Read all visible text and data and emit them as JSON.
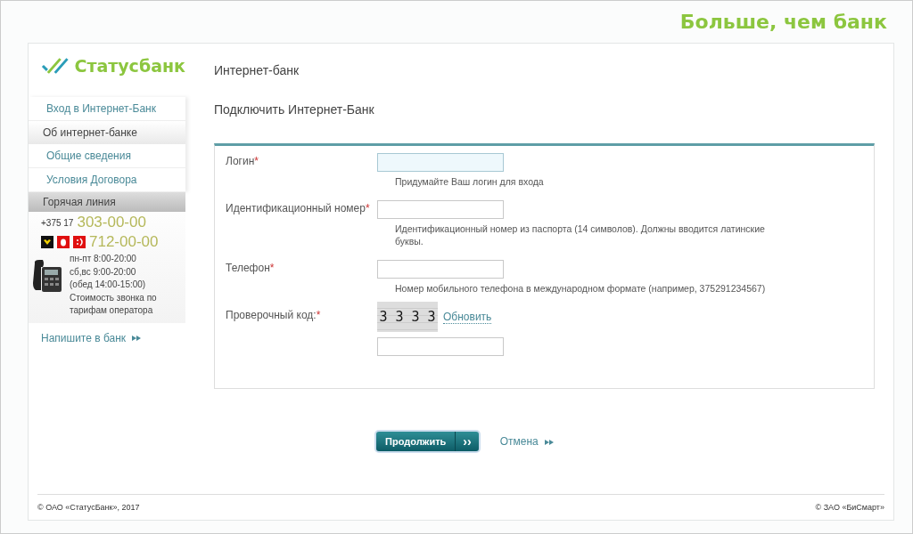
{
  "slogan": "Больше, чем банк",
  "logo": {
    "text": "Статусбанк"
  },
  "sidebar": {
    "items": [
      {
        "label": "Вход в Интернет-Банк",
        "kind": "link"
      },
      {
        "label": "Об интернет-банке",
        "kind": "section"
      },
      {
        "label": "Общие сведения",
        "kind": "link"
      },
      {
        "label": "Условия Договора",
        "kind": "link"
      }
    ],
    "hotline": {
      "title": "Горячая линия",
      "prefix": "+375 17",
      "city_number": "303-00-00",
      "mobile_number": "712-00-00",
      "hours": [
        "пн-пт 8:00-20:00",
        "сб,вс 9:00-20:00",
        "(обед 14:00-15:00)",
        "Стоимость звонка по тарифам оператора"
      ]
    },
    "write_link": "Напишите в банк"
  },
  "section_title": "Интернет-банк",
  "page_title": "Подключить Интернет-Банк",
  "form": {
    "fields": [
      {
        "label": "Логин",
        "mark": "*",
        "kind": "text",
        "focused": true,
        "hint": "Придумайте Ваш логин для входа"
      },
      {
        "label": "Идентификационный номер",
        "mark": "*",
        "kind": "text",
        "focused": false,
        "hint": "Идентификационный номер из паспорта (14 символов). Должны вводится латинские буквы."
      },
      {
        "label": "Телефон",
        "mark": "*",
        "kind": "text",
        "focused": false,
        "hint": "Номер мобильного телефона в международном формате (например, 375291234567)"
      },
      {
        "label": "Проверочный код:",
        "mark": "*",
        "kind": "captcha",
        "focused": false,
        "captcha": "3 3 3 3",
        "refresh": "Обновить"
      }
    ]
  },
  "buttons": {
    "continue": "Продолжить",
    "continue_arrow": "››",
    "cancel": "Отмена"
  },
  "footer": {
    "left": "© ОАО «СтатусБанк», 2017",
    "right": "© ЗАО «БиСмарт»"
  }
}
